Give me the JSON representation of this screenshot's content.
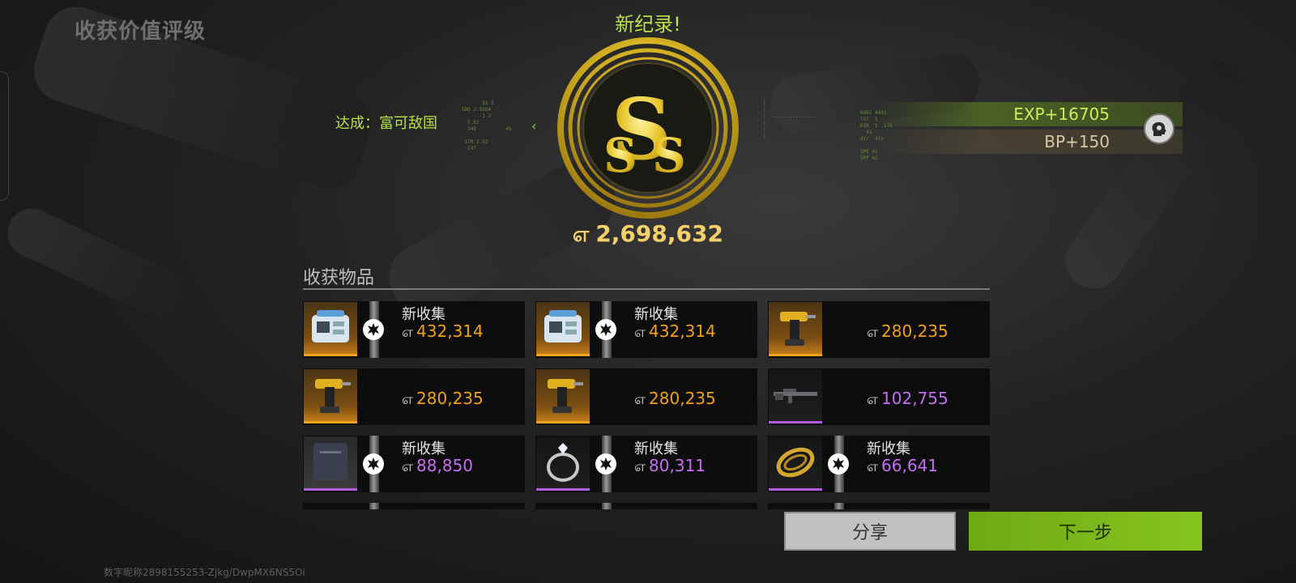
{
  "header": {
    "title": "收获价值评级",
    "record_label": "新纪录!",
    "achievement": "达成：富可敌国"
  },
  "grade": {
    "rank": "SSS",
    "total_value": "2,698,632",
    "currency_icon": "coin-icon",
    "color": "#f3d06a"
  },
  "rewards": {
    "exp": "EXP+16705",
    "bp": "BP+150"
  },
  "items_section": {
    "title": "收获物品"
  },
  "items": [
    {
      "icon": "generator-icon",
      "rarity": "gold",
      "new_label": "新收集",
      "value": "432,314",
      "badge": true
    },
    {
      "icon": "generator-icon",
      "rarity": "gold",
      "new_label": "新收集",
      "value": "432,314",
      "badge": true
    },
    {
      "icon": "drill-icon",
      "rarity": "gold",
      "new_label": "",
      "value": "280,235",
      "badge": false
    },
    {
      "icon": "drill-icon",
      "rarity": "gold",
      "new_label": "",
      "value": "280,235",
      "badge": false
    },
    {
      "icon": "drill-icon",
      "rarity": "gold",
      "new_label": "",
      "value": "280,235",
      "badge": false
    },
    {
      "icon": "rifle-icon",
      "rarity": "purple",
      "new_label": "",
      "value": "102,755",
      "badge": false
    },
    {
      "icon": "armor-plate-icon",
      "rarity": "purple",
      "new_label": "新收集",
      "value": "88,850",
      "badge": true
    },
    {
      "icon": "diamond-ring-icon",
      "rarity": "purple",
      "new_label": "新收集",
      "value": "80,311",
      "badge": true
    },
    {
      "icon": "gold-chain-icon",
      "rarity": "purple",
      "new_label": "新收集",
      "value": "66,641",
      "badge": true
    }
  ],
  "colors": {
    "gold_value": "#f2a01a",
    "purple_value": "#c46ef2",
    "accent_green": "#b8e04a",
    "next_button": "#7bb51a"
  },
  "buttons": {
    "share": "分享",
    "next": "下一步"
  },
  "footer": {
    "user_id": "数字昵称2898155253-Zjkg/DwpMX6NS5Oi"
  }
}
